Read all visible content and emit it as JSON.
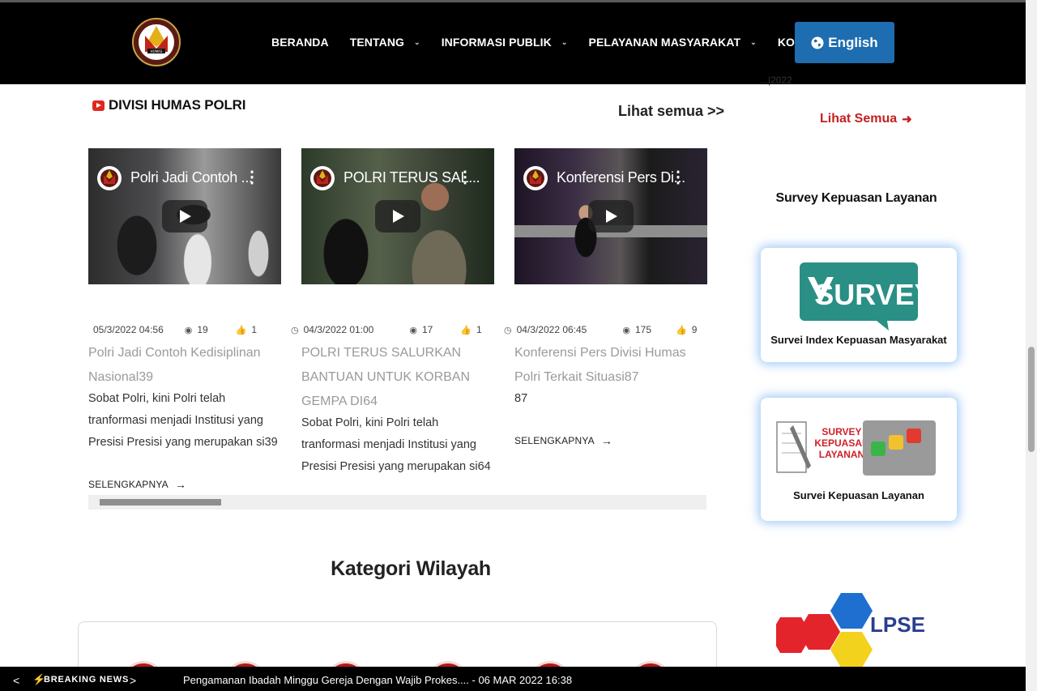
{
  "nav": {
    "items": [
      {
        "label": "BERANDA",
        "dropdown": false
      },
      {
        "label": "TENTANG",
        "dropdown": true
      },
      {
        "label": "INFORMASI PUBLIK",
        "dropdown": true
      },
      {
        "label": "PELAYANAN MASYARAKAT",
        "dropdown": true
      },
      {
        "label": "KONTAK",
        "dropdown": false
      }
    ],
    "language_button": "English",
    "logo_icon": "humas-polri-logo"
  },
  "section": {
    "title": "DIVISI HUMAS POLRI",
    "see_all": "Lihat semua >>"
  },
  "videos": [
    {
      "thumb_title": "Polri Jadi Contoh ...",
      "date": "05/3/2022 04:56",
      "views": "19",
      "likes": "1",
      "title": "Polri Jadi Contoh Kedisiplinan Nasional39",
      "desc": "Sobat Polri, kini Polri telah tranformasi menjadi Institusi yang Presisi Presisi yang merupakan si39",
      "more": "SELENGKAPNYA"
    },
    {
      "thumb_title": "POLRI TERUS SAL...",
      "date": "04/3/2022 01:00",
      "views": "17",
      "likes": "1",
      "title": "POLRI TERUS SALURKAN BANTUAN UNTUK KORBAN GEMPA DI64",
      "desc": "Sobat Polri, kini Polri telah tranformasi menjadi Institusi yang Presisi Presisi yang merupakan si64",
      "more": "SELENGKAPNYA"
    },
    {
      "thumb_title": "Konferensi Pers Di...",
      "date": "04/3/2022 06:45",
      "views": "175",
      "likes": "9",
      "title": "Konferensi Pers Divisi Humas Polri Terkait Situasi87",
      "desc": "87",
      "more": "SELENGKAPNYA"
    }
  ],
  "kategori": {
    "title": "Kategori Wilayah"
  },
  "sidebar": {
    "date_fragment": "...|2022",
    "see_all": "Lihat Semua",
    "survey_heading": "Survey Kepuasan Layanan",
    "cards": [
      {
        "label": "Survei Index Kepuasan Masyarakat",
        "logo_text": "SURVEY"
      },
      {
        "label": "Survei Kepuasan Layanan",
        "logo_text": "SURVEY KEPUASAN LAYANAN"
      }
    ],
    "lpse_text": "LPSE"
  },
  "breaking": {
    "label": "BREAKING NEWS",
    "ticker": "Pengamanan Ibadah Minggu Gereja Dengan Wajib Prokes.... - 06 MAR 2022 16:38"
  },
  "colors": {
    "nav_bg": "#000000",
    "english_button": "#1e6db0",
    "accent_red": "#c42020",
    "card_glow": "#5aa0f0"
  }
}
